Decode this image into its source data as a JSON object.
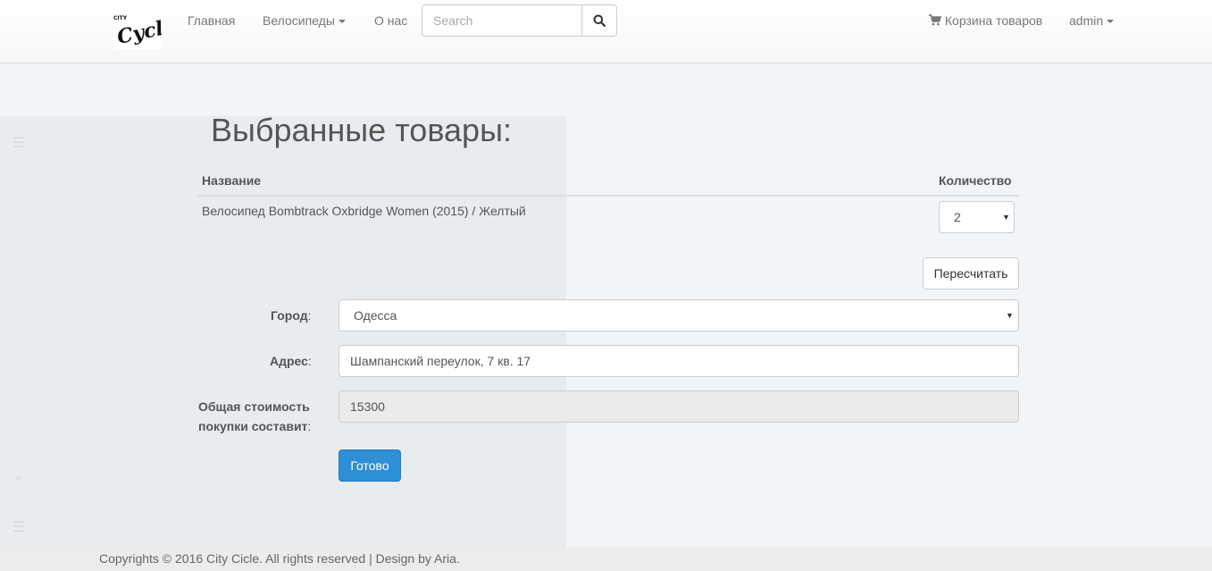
{
  "nav": {
    "logo_text": "City Cycle",
    "home": "Главная",
    "bicycles": "Велосипеды",
    "about": "О нас",
    "search_placeholder": "Search",
    "cart": "Корзина товаров",
    "user": "admin"
  },
  "cart": {
    "title": "Выбранные товары:",
    "columns": {
      "name": "Название",
      "quantity": "Количество"
    },
    "items": [
      {
        "name": "Велосипед Bombtrack Oxbridge Women (2015) / Желтый",
        "quantity": "2"
      }
    ],
    "recalculate_button": "Пересчитать"
  },
  "form": {
    "city_label": "Город",
    "city_value": "Одесса",
    "address_label": "Адрес",
    "address_value": "Шампанский переулок, 7 кв. 17",
    "total_label_line1": "Общая стоимость",
    "total_label_line2": "покупки составит",
    "total_value": "15300",
    "colon": ":",
    "submit_button": "Готово"
  },
  "footer": {
    "text": "Copyrights © 2016 City Cicle. All rights reserved | Design by Aria."
  },
  "icons": {
    "caret": "caret-down-icon",
    "search": "search-icon",
    "cart": "shopping-cart-icon"
  }
}
